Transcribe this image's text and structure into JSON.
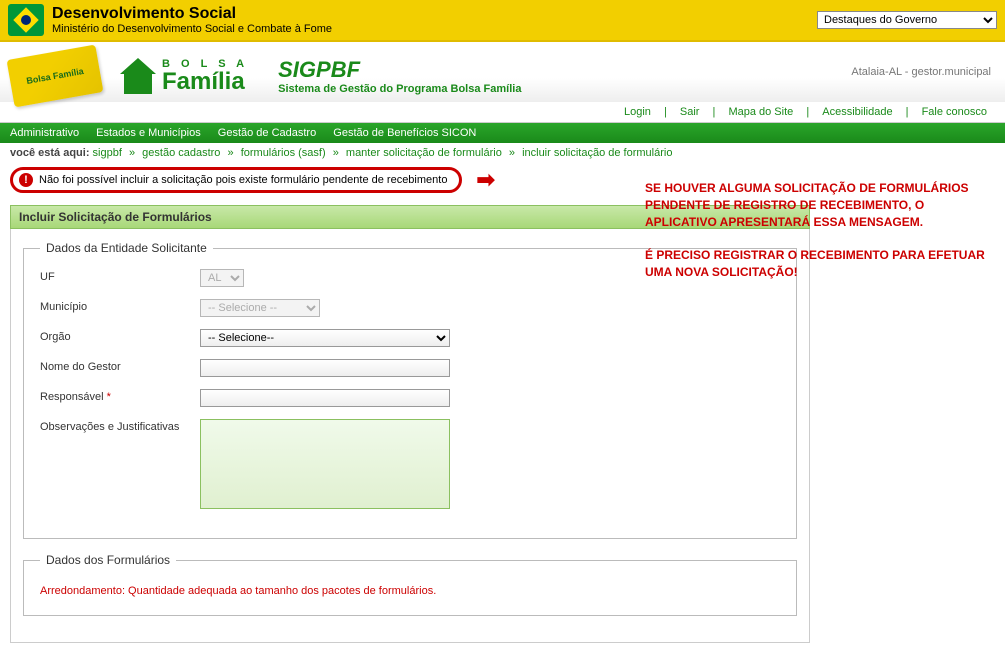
{
  "header": {
    "title": "Desenvolvimento Social",
    "subtitle": "Ministério do Desenvolvimento Social e Combate à Fome",
    "highlights_label": "Destaques do Governo"
  },
  "banner": {
    "card_text": "Bolsa Família",
    "bolsa_small": "B O L S A",
    "bolsa_big": "Família",
    "sigpbf_title": "SIGPBF",
    "sigpbf_sub": "Sistema de Gestão do Programa Bolsa Família",
    "user_context": "Atalaia-AL - gestor.municipal"
  },
  "links": {
    "login": "Login",
    "sair": "Sair",
    "mapa": "Mapa do Site",
    "acess": "Acessibilidade",
    "fale": "Fale conosco"
  },
  "menu": {
    "admin": "Administrativo",
    "estados": "Estados e Municípios",
    "gestao_cad": "Gestão de Cadastro",
    "gestao_ben": "Gestão de Benefícios  SICON"
  },
  "breadcrumb": {
    "label": "você está aqui:",
    "p1": "sigpbf",
    "p2": "gestão cadastro",
    "p3": "formulários (sasf)",
    "p4": "manter solicitação de formulário",
    "p5": "incluir solicitação de formulário"
  },
  "error": {
    "message": "Não foi possível incluir a solicitação pois existe formulário pendente de recebimento"
  },
  "annotation": {
    "line1": "SE HOUVER ALGUMA SOLICITAÇÃO DE FORMULÁRIOS PENDENTE DE REGISTRO DE RECEBIMENTO, O APLICATIVO APRESENTARÁ ESSA MENSAGEM.",
    "line2": "É PRECISO REGISTRAR O RECEBIMENTO PARA EFETUAR UMA NOVA SOLICITAÇÃO!"
  },
  "panel": {
    "title": "Incluir Solicitação de Formulários",
    "fieldset1_legend": "Dados da Entidade Solicitante",
    "fieldset2_legend": "Dados dos Formulários",
    "labels": {
      "uf": "UF",
      "municipio": "Município",
      "orgao": "Orgão",
      "nome_gestor": "Nome do Gestor",
      "responsavel": "Responsável",
      "observacoes": "Observações e Justificativas"
    },
    "values": {
      "uf_selected": "AL",
      "mun_placeholder": "-- Selecione --",
      "orgao_placeholder": "-- Selecione--"
    },
    "arredond": "Arredondamento: Quantidade adequada ao tamanho dos pacotes de formulários."
  }
}
